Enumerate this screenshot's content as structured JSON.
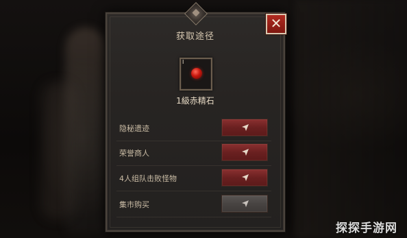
{
  "dialog": {
    "title": "获取途径",
    "close_glyph": "✕",
    "item": {
      "level": "Ⅰ",
      "name": "1級赤精石",
      "icon": "red-gem-icon",
      "color": "#c8180e"
    },
    "sources": [
      {
        "label": "隐秘遗迹",
        "button_state": "active",
        "button_icon": "navigate-arrow-icon"
      },
      {
        "label": "荣誉商人",
        "button_state": "active",
        "button_icon": "navigate-arrow-icon"
      },
      {
        "label": "4人组队击败怪物",
        "button_state": "active",
        "button_icon": "navigate-arrow-icon"
      },
      {
        "label": "集市购买",
        "button_state": "disabled",
        "button_icon": "navigate-arrow-icon"
      }
    ]
  },
  "watermark": "探探手游网",
  "colors": {
    "active_button": "#7a2828",
    "disabled_button": "#4a4644",
    "close_button": "#a82418",
    "text": "#cbbda6"
  }
}
